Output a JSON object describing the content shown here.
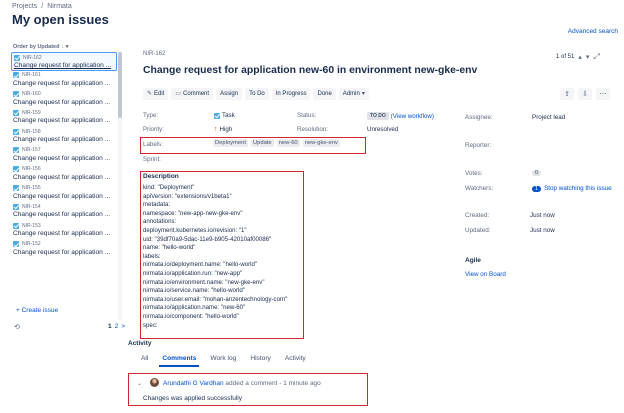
{
  "breadcrumb": [
    "Projects",
    "/",
    "Nirmata"
  ],
  "page_title": "My open issues",
  "advanced_search": "Advanced search",
  "list": {
    "order_by": "Order by Updated",
    "items": [
      {
        "key": "NIR-162",
        "summary": "Change request for application ..."
      },
      {
        "key": "NIR-161",
        "summary": "Change request for application ..."
      },
      {
        "key": "NIR-160",
        "summary": "Change request for application ..."
      },
      {
        "key": "NIR-159",
        "summary": "Change request for application ..."
      },
      {
        "key": "NIR-158",
        "summary": "Change request for application ..."
      },
      {
        "key": "NIR-157",
        "summary": "Change request for application ..."
      },
      {
        "key": "NIR-156",
        "summary": "Change request for application ..."
      },
      {
        "key": "NIR-155",
        "summary": "Change request for application ..."
      },
      {
        "key": "NIR-154",
        "summary": "Change request for application ..."
      },
      {
        "key": "NIR-153",
        "summary": "Change request for application ..."
      },
      {
        "key": "NIR-152",
        "summary": "Change request for application ..."
      }
    ],
    "create_issue": "+ Create issue",
    "page_current": "1",
    "page_next": "2",
    "page_arrow": ">"
  },
  "issue": {
    "key": "NIR-162",
    "pager": "1 of 51",
    "title": "Change request for application new-60 in environment new-gke-env",
    "toolbar": {
      "edit": "Edit",
      "comment": "Comment",
      "assign": "Assign",
      "todo": "To Do",
      "in_progress": "In Progress",
      "done": "Done",
      "admin": "Admin"
    },
    "fields": {
      "type_label": "Type:",
      "type_value": "Task",
      "priority_label": "Priority:",
      "priority_value": "High",
      "labels_label": "Labels:",
      "labels": [
        "Deployment",
        "Update",
        "new-60",
        "new-gke-env"
      ],
      "sprint_label": "Sprint:",
      "status_label": "Status:",
      "status_value": "TO DO",
      "view_workflow": "(View workflow)",
      "resolution_label": "Resolution:",
      "resolution_value": "Unresolved"
    },
    "description_title": "Description",
    "description": "kind: \"Deployment\"\napiVersion: \"extensions/v1beta1\"\nmetadata:\nnamespace: \"new-app-new-gke-env\"\nannotations:\ndeployment.kubernetes.io/revision: \"1\"\nuid: \"39df70a9-5dac-11e9-b905-42010af00086\"\nname: \"hello-world\"\nlabels:\nnirmata.io/deployment.name: \"hello-world\"\nnirmata.io/application.run: \"new-app\"\nnirmata.io/environment.name: \"new-gke-env\"\nnirmata.io/service.name: \"hello-world\"\nnirmata.io/user.email: \"mohan-anzentechnology-com\"\nnirmata.io/application.name: \"new-60\"\nnirmata.io/component: \"hello-world\"\nspec:",
    "activity": {
      "title": "Activity",
      "tabs": [
        "All",
        "Comments",
        "Work log",
        "History",
        "Activity"
      ],
      "active_tab": "Comments",
      "comment_author": "Arundathi G Vardhan",
      "comment_meta": " added a comment - 1 minute ago",
      "comment_text": "Changes was applied successfully"
    },
    "people": {
      "assignee_label": "Assignee:",
      "assignee_value": "Project lead",
      "reporter_label": "Reporter:",
      "votes_label": "Votes:",
      "votes_value": "0",
      "watchers_label": "Watchers:",
      "watchers_value": "1",
      "stop_watching": "Stop watching this issue"
    },
    "dates": {
      "created_label": "Created:",
      "created_value": "Just now",
      "updated_label": "Updated:",
      "updated_value": "Just now"
    },
    "agile": {
      "title": "Agile",
      "view_on_board": "View on Board"
    }
  },
  "colors": {
    "accent": "#0052cc",
    "highlight_box": "#d0282e",
    "task_icon": "#4bade8"
  }
}
